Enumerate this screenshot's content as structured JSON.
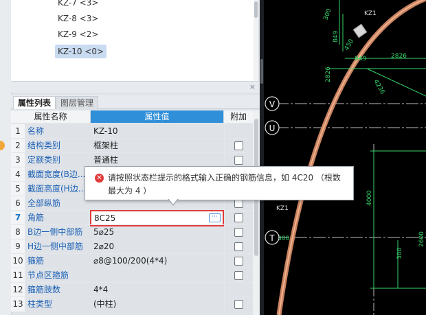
{
  "tree": {
    "items": [
      {
        "label": "KZ-7 <3>",
        "selected": false
      },
      {
        "label": "KZ-8 <3>",
        "selected": false
      },
      {
        "label": "KZ-9 <2>",
        "selected": false
      },
      {
        "label": "KZ-10 <0>",
        "selected": true
      }
    ]
  },
  "panel_close": "×",
  "tabs": {
    "properties": "属性列表",
    "layers": "图层管理"
  },
  "grid": {
    "headers": {
      "name": "属性名称",
      "value": "属性值",
      "extra": "附加"
    },
    "rows": [
      {
        "num": "1",
        "name": "名称",
        "value": "KZ-10",
        "checkbox": false
      },
      {
        "num": "2",
        "name": "结构类别",
        "value": "框架柱",
        "checkbox": true
      },
      {
        "num": "3",
        "name": "定额类别",
        "value": "普通柱",
        "checkbox": true
      },
      {
        "num": "4",
        "name": "截面宽度(B边...",
        "value": "",
        "checkbox": true
      },
      {
        "num": "5",
        "name": "截面高度(H边...",
        "value": "",
        "checkbox": true
      },
      {
        "num": "6",
        "name": "全部纵筋",
        "value": "",
        "checkbox": true
      },
      {
        "num": "7",
        "name": "角筋",
        "value": "8C25",
        "checkbox": true
      },
      {
        "num": "8",
        "name": "B边一侧中部筋",
        "value": "5⌀25",
        "checkbox": true
      },
      {
        "num": "9",
        "name": "H边一侧中部筋",
        "value": "2⌀20",
        "checkbox": true
      },
      {
        "num": "10",
        "name": "箍筋",
        "value": "⌀8@100/200(4*4)",
        "checkbox": true
      },
      {
        "num": "11",
        "name": "节点区箍筋",
        "value": "",
        "checkbox": true
      },
      {
        "num": "12",
        "name": "箍筋肢数",
        "value": "4*4",
        "checkbox": false
      },
      {
        "num": "13",
        "name": "柱类型",
        "value": "(中柱)",
        "checkbox": true
      }
    ],
    "active_row_index": 6,
    "active_button": "···"
  },
  "tooltip": {
    "message": "请按照状态栏提示的格式输入正确的钢筋信息，如 4C20 （根数最大为 4 ）"
  },
  "canvas": {
    "axis_labels": [
      "V",
      "U",
      "T"
    ],
    "dims": [
      "300",
      "849",
      "450",
      "KZ1",
      "2826",
      "2826",
      "849",
      "4236",
      "4000",
      "300",
      "KZ1",
      "300",
      "2600"
    ]
  },
  "colors": {
    "accent": "#2f8fd8",
    "error": "#e23b3b",
    "canvas_bg": "#000000",
    "dim_green": "#36d66a"
  }
}
